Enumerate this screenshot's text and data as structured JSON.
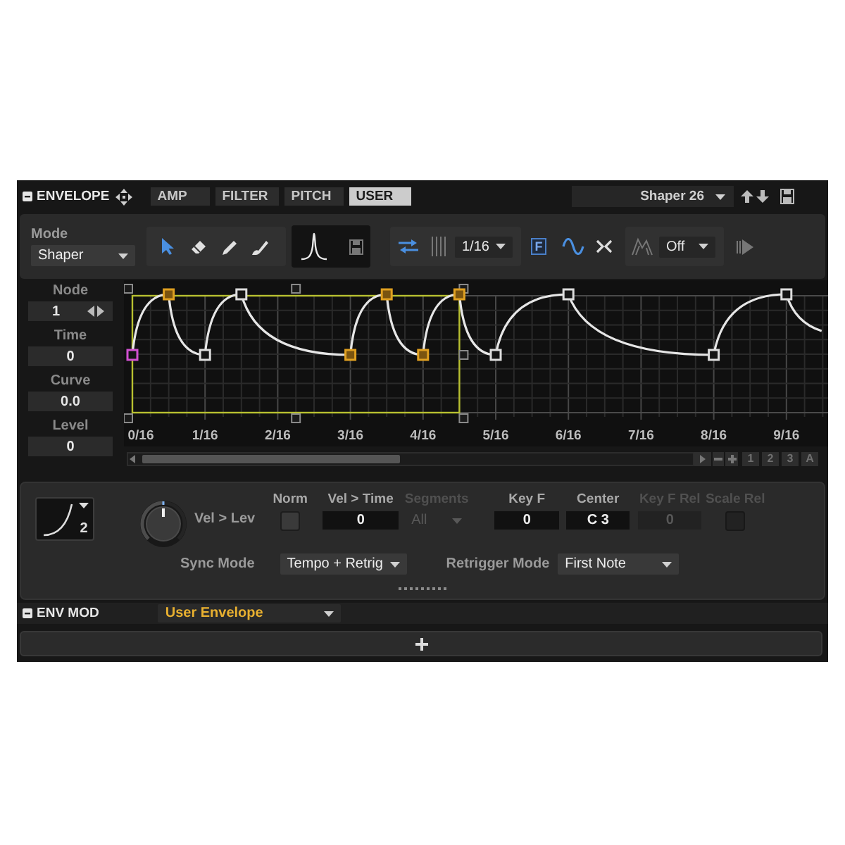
{
  "envelope": {
    "title": "ENVELOPE",
    "tabs": [
      {
        "label": "AMP",
        "selected": false
      },
      {
        "label": "FILTER",
        "selected": false
      },
      {
        "label": "PITCH",
        "selected": false
      },
      {
        "label": "USER",
        "selected": true
      }
    ],
    "preset": "Shaper 26"
  },
  "toolbar": {
    "mode_label": "Mode",
    "mode": "Shaper",
    "edit_tools": [
      {
        "kind": "pointer",
        "selected": true
      },
      {
        "kind": "eraser",
        "selected": false
      },
      {
        "kind": "pencil",
        "selected": false
      },
      {
        "kind": "brush",
        "selected": false
      }
    ],
    "link_toggle": {
      "on": true
    },
    "grid": "1/16",
    "f_toggle": {
      "label": "F",
      "on": true
    },
    "wave_toggle": {
      "on": true
    },
    "cross_toggle": {
      "on": false
    },
    "shape_mode": "Off"
  },
  "node_panel": [
    {
      "label": "Node",
      "value": "1",
      "kind": "stepper"
    },
    {
      "label": "Time",
      "value": "0",
      "kind": "field"
    },
    {
      "label": "Curve",
      "value": "0.0",
      "kind": "field"
    },
    {
      "label": "Level",
      "value": "0",
      "kind": "field"
    }
  ],
  "graph": {
    "nodes": [
      {
        "selected": false,
        "current": true
      },
      {
        "selected": true,
        "current": false
      },
      {
        "selected": false,
        "current": false
      },
      {
        "selected": false,
        "current": false
      },
      {
        "selected": true,
        "current": false
      },
      {
        "selected": true,
        "current": false
      },
      {
        "selected": true,
        "current": false
      },
      {
        "selected": true,
        "current": false
      },
      {
        "selected": false,
        "current": false
      },
      {
        "selected": false,
        "current": false
      },
      {
        "selected": false,
        "current": false
      },
      {
        "selected": false,
        "current": false
      }
    ],
    "time_ruler": [
      "0/16",
      "1/16",
      "2/16",
      "3/16",
      "4/16",
      "5/16",
      "6/16",
      "7/16",
      "8/16",
      "9/16"
    ]
  },
  "view_buttons": [
    "1",
    "2",
    "3",
    "A"
  ],
  "settings": {
    "curve_shape": "2",
    "knob": {
      "label": "Vel > Lev",
      "level": 0.5
    },
    "params": [
      {
        "kind": "checkbox",
        "label": "Norm",
        "checked": false,
        "disabled": false
      },
      {
        "kind": "field",
        "label": "Vel > Time",
        "value": "0",
        "disabled": false
      },
      {
        "kind": "dropdown",
        "label": "Segments",
        "value": "All",
        "disabled": true
      },
      {
        "kind": "field",
        "label": "Key F",
        "value": "0",
        "disabled": false
      },
      {
        "kind": "field",
        "label": "Center",
        "value": "C 3",
        "disabled": false
      },
      {
        "kind": "field",
        "label": "Key F Rel",
        "value": "0",
        "disabled": true
      },
      {
        "kind": "checkbox",
        "label": "Scale Rel",
        "checked": false,
        "disabled": true
      }
    ],
    "sync_mode": {
      "label": "Sync Mode",
      "value": "Tempo + Retrig"
    },
    "retrigger_mode": {
      "label": "Retrigger Mode",
      "value": "First Note"
    }
  },
  "env_mod": {
    "title": "ENV MOD",
    "source": "User Envelope"
  }
}
